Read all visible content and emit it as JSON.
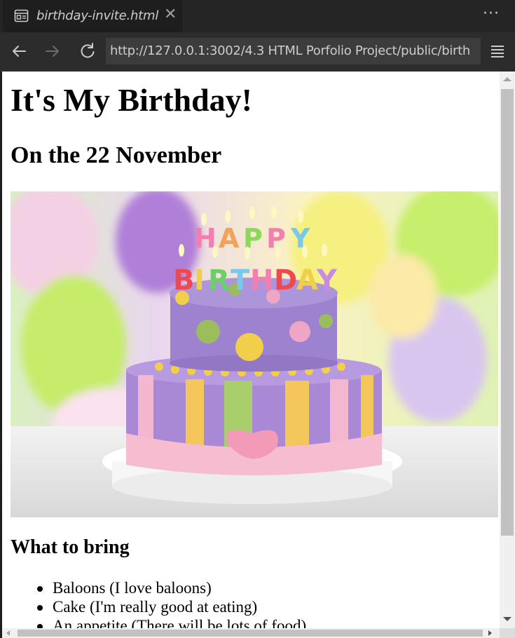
{
  "tab": {
    "title": "birthday-invite.html",
    "close_glyph": "✕",
    "icon": "preview-icon"
  },
  "more_glyph": "···",
  "nav": {
    "url": "http://127.0.0.1:3002/4.3 HTML Porfolio Project/public/birth",
    "back_icon": "arrow-left-icon",
    "forward_icon": "arrow-right-icon",
    "reload_icon": "reload-icon",
    "menu_icon": "hamburger-menu-icon"
  },
  "page": {
    "heading": "It's My Birthday!",
    "subheading": "On the 22 November",
    "image_subject": "birthday-cake-photo",
    "bring_heading": "What to bring",
    "items": [
      "Baloons (I love baloons)",
      "Cake (I'm really good at eating)",
      "An appetite (There will be lots of food)"
    ]
  },
  "colors": {
    "titlebar": "#252526",
    "navbar": "#2c2c2c",
    "urlbox": "#3c3c3c",
    "text": "#cccccc"
  }
}
